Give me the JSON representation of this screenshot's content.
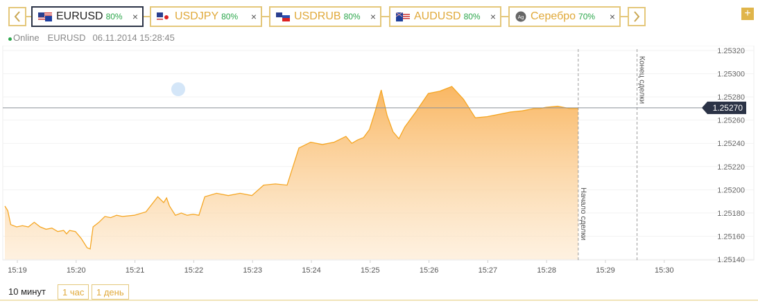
{
  "nav": {
    "prev_icon": "chevron-left-icon",
    "next_icon": "chevron-right-icon",
    "add_icon": "plus-icon",
    "add_label": "+"
  },
  "tabs": [
    {
      "symbol": "EURUSD",
      "payout": "80%",
      "flag": "us-eu-flag-icon",
      "active": true
    },
    {
      "symbol": "USDJPY",
      "payout": "80%",
      "flag": "us-jp-flag-icon",
      "active": false
    },
    {
      "symbol": "USDRUB",
      "payout": "80%",
      "flag": "us-ru-flag-icon",
      "active": false
    },
    {
      "symbol": "AUDUSD",
      "payout": "80%",
      "flag": "au-us-flag-icon",
      "active": false
    },
    {
      "symbol": "Серебро",
      "payout": "70%",
      "flag": "silver-icon",
      "active": false
    }
  ],
  "close_label": "×",
  "status": {
    "state": "Online",
    "symbol": "EURUSD",
    "datetime": "06.11.2014 15:28:45"
  },
  "chart_data": {
    "type": "area",
    "xlabel": "",
    "ylabel": "",
    "x_ticks": [
      "15:19",
      "15:20",
      "15:21",
      "15:22",
      "15:23",
      "15:24",
      "15:25",
      "15:26",
      "15:27",
      "15:28",
      "15:29",
      "15:30"
    ],
    "y_ticks": [
      "1.25320",
      "1.25300",
      "1.25280",
      "1.25260",
      "1.25240",
      "1.25220",
      "1.25200",
      "1.25180",
      "1.25160",
      "1.25140"
    ],
    "ylim": [
      1.2514,
      1.2532
    ],
    "current_price": "1.25270",
    "current_value": 1.2527,
    "markers": [
      {
        "label": "Начало сделки",
        "time": "15:28:45"
      },
      {
        "label": "Конец сделки",
        "time": "15:29:45"
      }
    ],
    "series": [
      {
        "t": [
          0.0,
          0.05,
          0.1,
          0.2,
          0.3,
          0.4,
          0.5,
          0.6,
          0.7,
          0.8,
          0.9,
          1.0,
          1.05,
          1.1,
          1.2,
          1.3,
          1.4,
          1.45,
          1.5,
          1.6,
          1.7,
          1.8,
          1.9,
          2.0,
          2.2,
          2.4,
          2.6,
          2.7,
          2.75,
          2.8,
          2.9,
          3.0,
          3.1,
          3.2,
          3.3,
          3.4,
          3.6,
          3.8,
          4.0,
          4.2,
          4.4,
          4.6,
          4.8,
          5.0,
          5.2,
          5.4,
          5.6,
          5.8,
          5.9,
          6.0,
          6.1,
          6.2,
          6.3,
          6.4,
          6.5,
          6.6,
          6.7,
          6.8,
          7.0,
          7.2,
          7.4,
          7.6,
          7.8,
          8.0,
          8.2,
          8.4,
          8.6,
          8.8,
          9.0,
          9.1,
          9.2,
          9.4,
          9.6,
          9.75
        ],
        "y": [
          1.25186,
          1.25182,
          1.2517,
          1.25168,
          1.25169,
          1.25168,
          1.25172,
          1.25168,
          1.25166,
          1.25167,
          1.25164,
          1.25165,
          1.25162,
          1.25165,
          1.25164,
          1.25158,
          1.2515,
          1.25149,
          1.25168,
          1.25172,
          1.25177,
          1.25176,
          1.25178,
          1.25177,
          1.25178,
          1.25181,
          1.25194,
          1.25189,
          1.25193,
          1.25186,
          1.25178,
          1.2518,
          1.25178,
          1.25179,
          1.25178,
          1.25194,
          1.25197,
          1.25195,
          1.25197,
          1.25195,
          1.25204,
          1.25205,
          1.25204,
          1.25236,
          1.25241,
          1.25239,
          1.25241,
          1.25246,
          1.2524,
          1.25243,
          1.25245,
          1.25252,
          1.25268,
          1.25286,
          1.25264,
          1.2525,
          1.25244,
          1.25254,
          1.25268,
          1.25283,
          1.25285,
          1.25289,
          1.25278,
          1.25262,
          1.25263,
          1.25265,
          1.25267,
          1.25268,
          1.2527,
          1.2527,
          1.25271,
          1.25272,
          1.2527,
          1.2527
        ]
      }
    ]
  },
  "range": {
    "active": "10 минут",
    "options": [
      "1 час",
      "1 день"
    ]
  }
}
